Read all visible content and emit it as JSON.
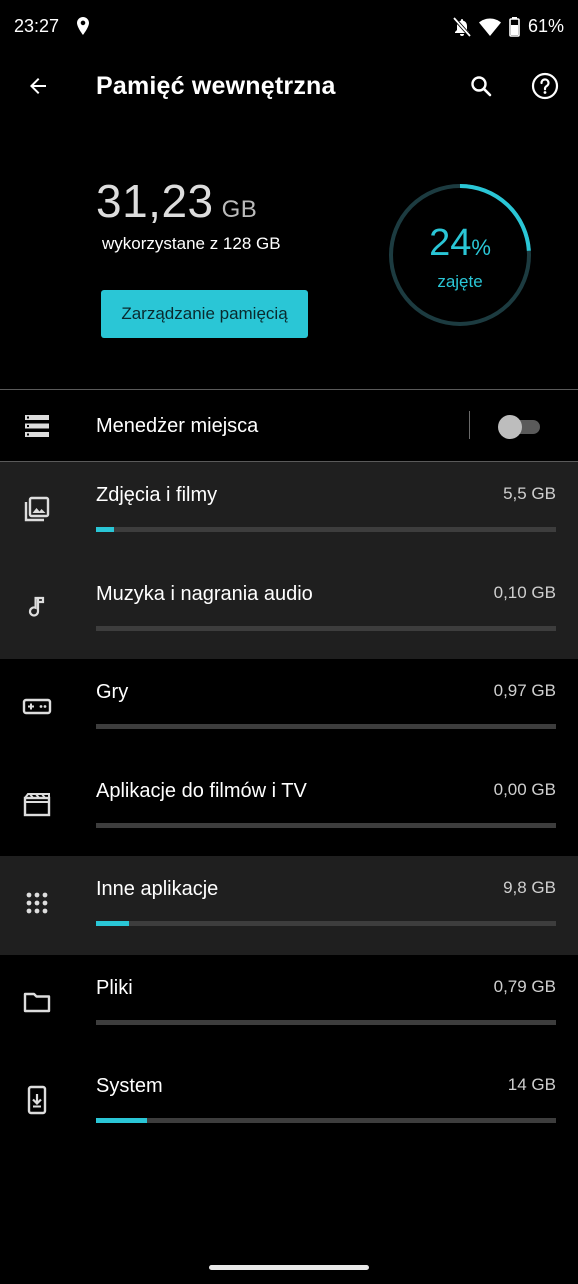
{
  "status_bar": {
    "time": "23:27",
    "battery": "61%"
  },
  "app_bar": {
    "title": "Pamięć wewnętrzna"
  },
  "summary": {
    "used_value": "31,23",
    "used_unit": "GB",
    "used_sub": "wykorzystane z 128 GB",
    "manage_button": "Zarządzanie pamięcią",
    "percent_value": "24",
    "percent_sign": "%",
    "percent_label": "zajęte",
    "used_fraction": 0.24
  },
  "space_manager": {
    "label": "Menedżer miejsca",
    "enabled": false
  },
  "categories": [
    {
      "label": "Zdjęcia i filmy",
      "size": "5,5 GB",
      "fraction": 0.04,
      "icon": "photo-library-icon",
      "shaded": true
    },
    {
      "label": "Muzyka i nagrania audio",
      "size": "0,10 GB",
      "fraction": 0.0,
      "icon": "music-note-icon",
      "shaded": true
    },
    {
      "label": "Gry",
      "size": "0,97 GB",
      "fraction": 0.0,
      "icon": "gamepad-icon",
      "shaded": false
    },
    {
      "label": "Aplikacje do filmów i TV",
      "size": "0,00 GB",
      "fraction": 0.0,
      "icon": "movie-icon",
      "shaded": false
    },
    {
      "label": "Inne aplikacje",
      "size": "9,8 GB",
      "fraction": 0.072,
      "icon": "apps-grid-icon",
      "shaded": true
    },
    {
      "label": "Pliki",
      "size": "0,79 GB",
      "fraction": 0.0,
      "icon": "folder-icon",
      "shaded": false
    },
    {
      "label": "System",
      "size": "14 GB",
      "fraction": 0.11,
      "icon": "system-update-icon",
      "shaded": false
    }
  ],
  "colors": {
    "accent": "#2ac6d6",
    "background": "#000000",
    "shaded_row": "#1f1f1f"
  }
}
